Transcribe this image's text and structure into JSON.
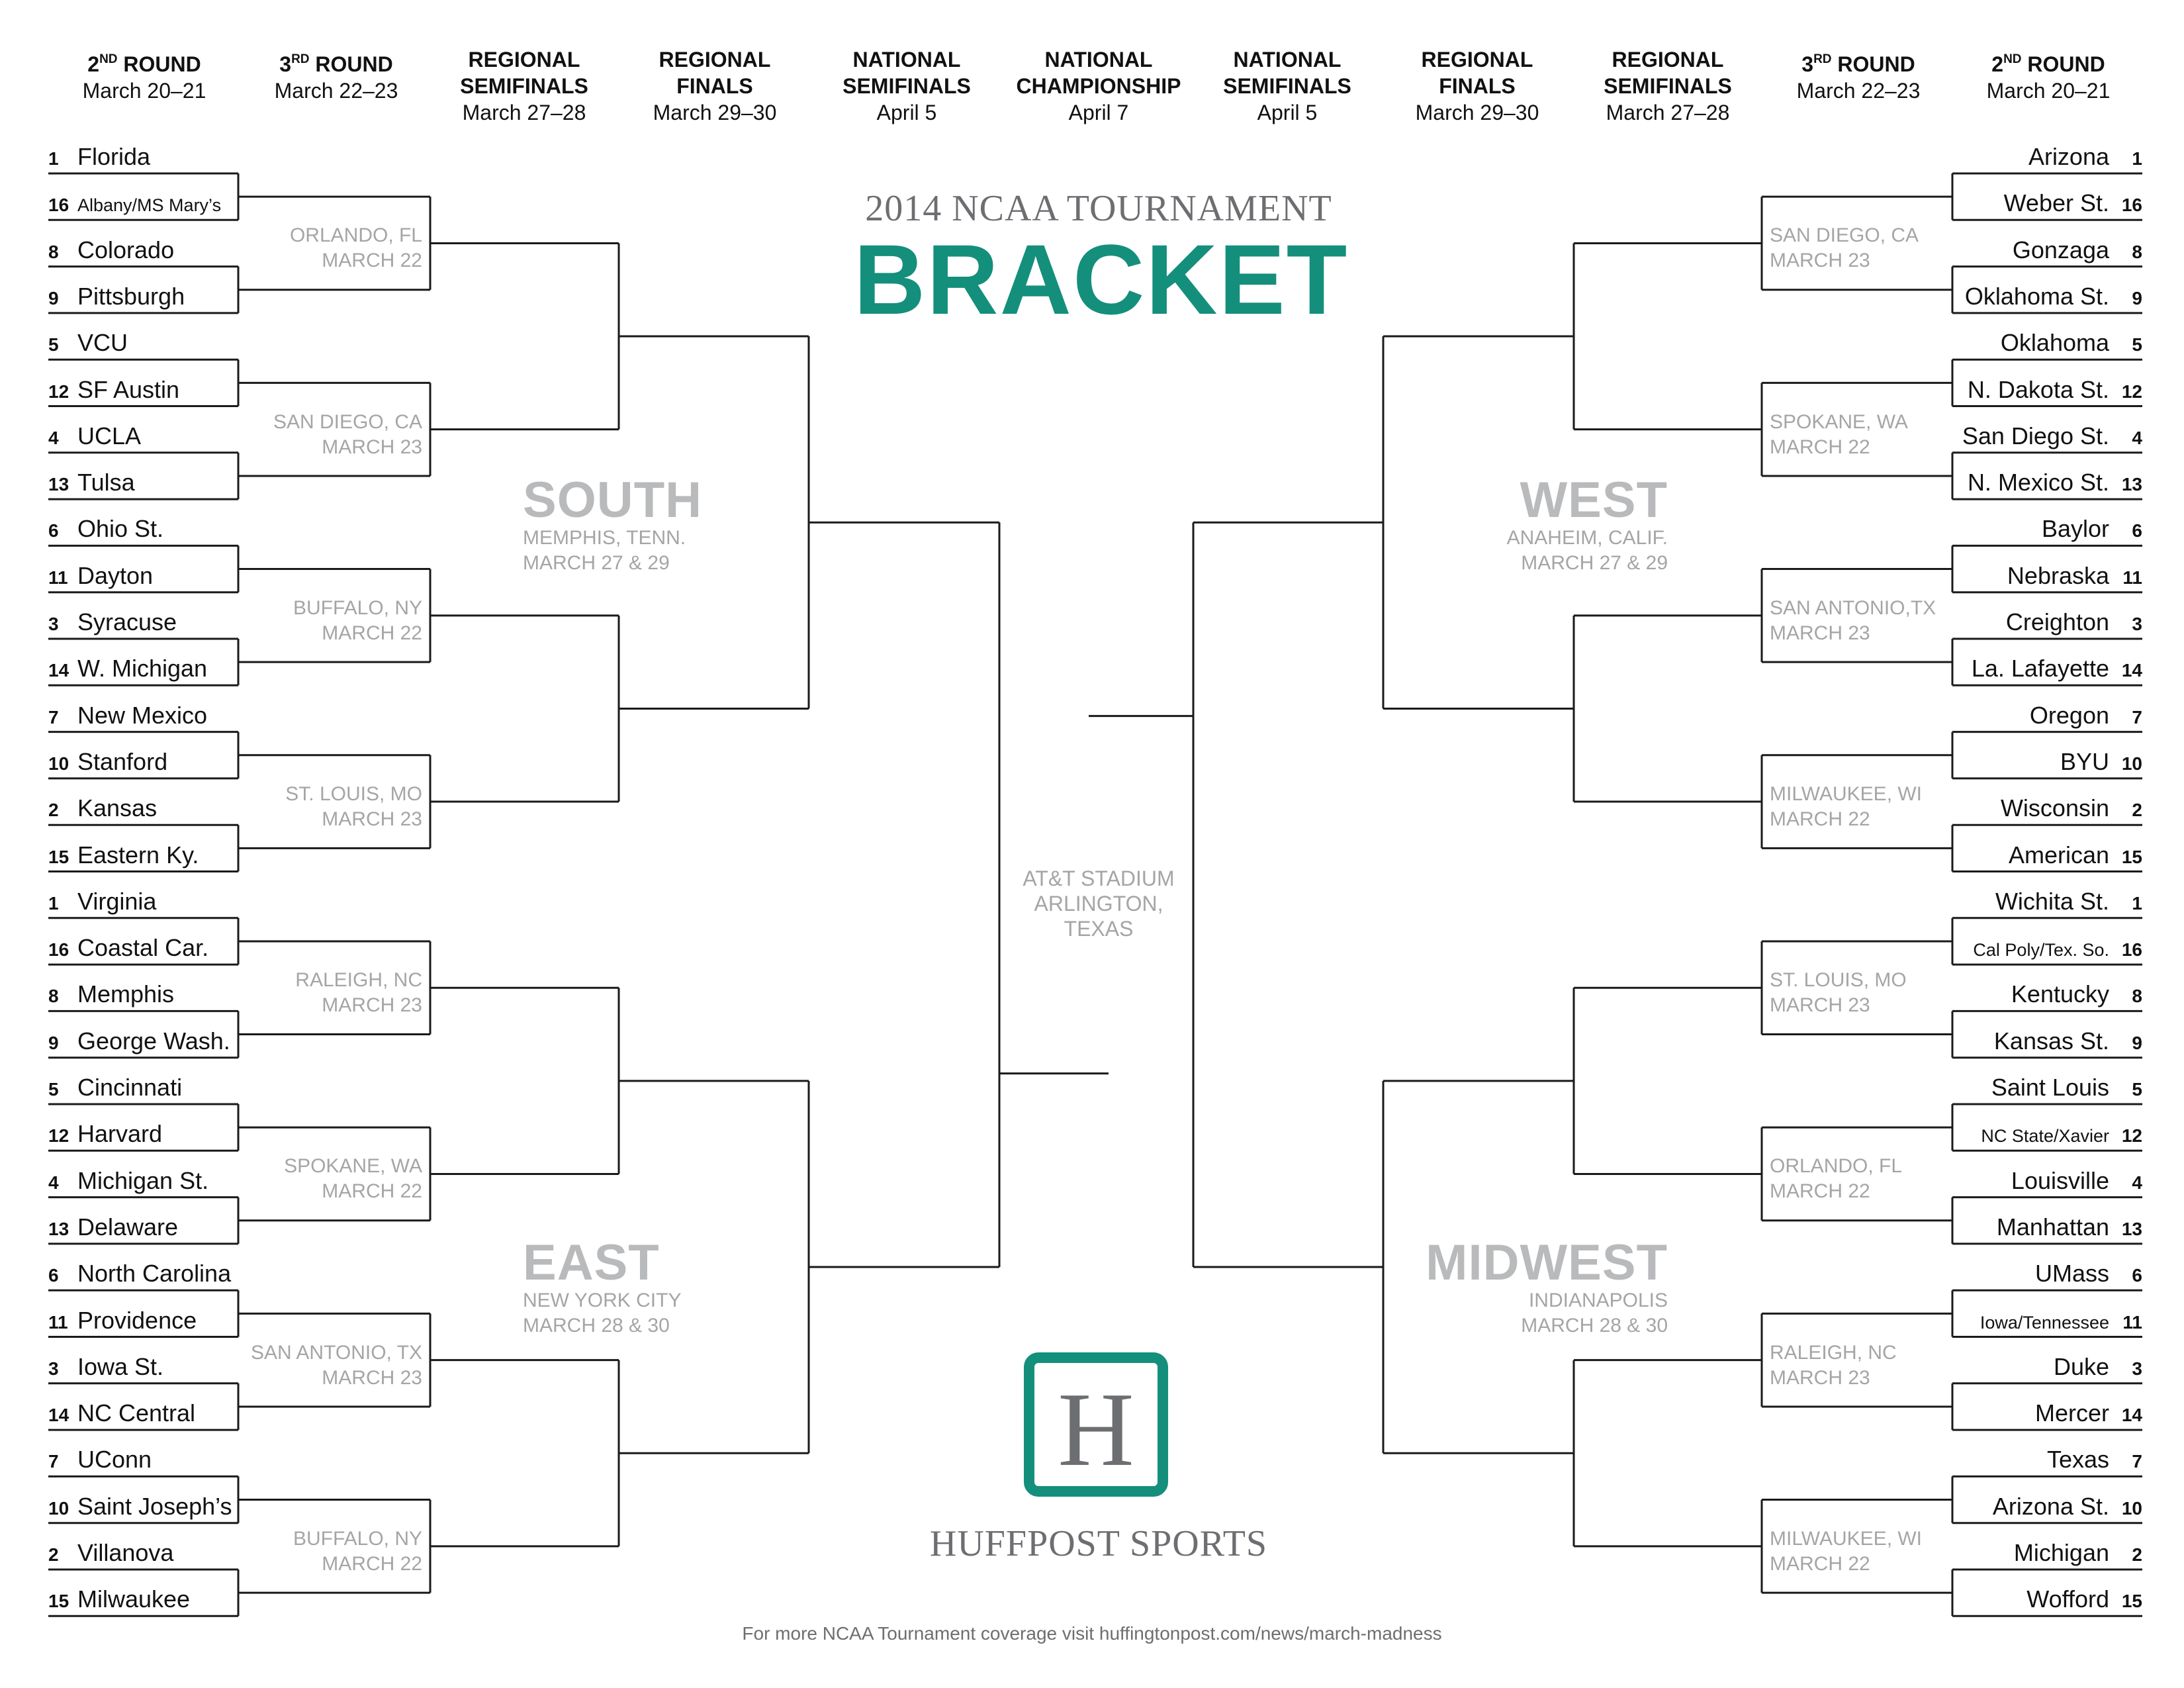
{
  "headers": [
    {
      "title": "2ND ROUND",
      "ord": "ND",
      "num": "2",
      "word": "ROUND",
      "date": "March 20–21"
    },
    {
      "title": "3RD ROUND",
      "ord": "RD",
      "num": "3",
      "word": "ROUND",
      "date": "March 22–23"
    },
    {
      "line1": "REGIONAL",
      "line2": "SEMIFINALS",
      "date": "March 27–28"
    },
    {
      "line1": "REGIONAL",
      "line2": "FINALS",
      "date": "March 29–30"
    },
    {
      "line1": "NATIONAL",
      "line2": "SEMIFINALS",
      "date": "April 5"
    },
    {
      "line1": "NATIONAL",
      "line2": "CHAMPIONSHIP",
      "date": "April 7"
    },
    {
      "line1": "NATIONAL",
      "line2": "SEMIFINALS",
      "date": "April 5"
    },
    {
      "line1": "REGIONAL",
      "line2": "FINALS",
      "date": "March 29–30"
    },
    {
      "line1": "REGIONAL",
      "line2": "SEMIFINALS",
      "date": "March 27–28"
    },
    {
      "title": "3RD ROUND",
      "ord": "RD",
      "num": "3",
      "word": "ROUND",
      "date": "March 22–23"
    },
    {
      "title": "2ND ROUND",
      "ord": "ND",
      "num": "2",
      "word": "ROUND",
      "date": "March 20–21"
    }
  ],
  "title": {
    "top": "2014 NCAA TOURNAMENT",
    "main": "BRACKET"
  },
  "championship_venue": [
    "AT&T STADIUM",
    "ARLINGTON,",
    "TEXAS"
  ],
  "logo": {
    "letter": "H",
    "text": "HUFFPOST SPORTS",
    "accent_color": "#148f7c"
  },
  "footer": "For more NCAA Tournament coverage visit huffingtonpost.com/news/march-madness",
  "regions": {
    "south": {
      "name": "SOUTH",
      "city": "MEMPHIS, TENN.",
      "dates": "MARCH 27 & 29"
    },
    "east": {
      "name": "EAST",
      "city": "NEW YORK CITY",
      "dates": "MARCH 28 & 30"
    },
    "west": {
      "name": "WEST",
      "city": "ANAHEIM, CALIF.",
      "dates": "MARCH 27 & 29"
    },
    "midwest": {
      "name": "MIDWEST",
      "city": "INDIANAPOLIS",
      "dates": "MARCH 28 & 30"
    }
  },
  "left_teams": [
    {
      "seed": "1",
      "name": "Florida"
    },
    {
      "seed": "16",
      "name": "Albany/MS Mary’s",
      "small": true
    },
    {
      "seed": "8",
      "name": "Colorado"
    },
    {
      "seed": "9",
      "name": "Pittsburgh"
    },
    {
      "seed": "5",
      "name": "VCU"
    },
    {
      "seed": "12",
      "name": "SF Austin"
    },
    {
      "seed": "4",
      "name": "UCLA"
    },
    {
      "seed": "13",
      "name": "Tulsa"
    },
    {
      "seed": "6",
      "name": "Ohio St."
    },
    {
      "seed": "11",
      "name": "Dayton"
    },
    {
      "seed": "3",
      "name": "Syracuse"
    },
    {
      "seed": "14",
      "name": "W. Michigan"
    },
    {
      "seed": "7",
      "name": "New Mexico"
    },
    {
      "seed": "10",
      "name": "Stanford"
    },
    {
      "seed": "2",
      "name": "Kansas"
    },
    {
      "seed": "15",
      "name": "Eastern Ky."
    },
    {
      "seed": "1",
      "name": "Virginia"
    },
    {
      "seed": "16",
      "name": "Coastal Car."
    },
    {
      "seed": "8",
      "name": "Memphis"
    },
    {
      "seed": "9",
      "name": "George Wash."
    },
    {
      "seed": "5",
      "name": "Cincinnati"
    },
    {
      "seed": "12",
      "name": "Harvard"
    },
    {
      "seed": "4",
      "name": "Michigan St."
    },
    {
      "seed": "13",
      "name": "Delaware"
    },
    {
      "seed": "6",
      "name": "North Carolina"
    },
    {
      "seed": "11",
      "name": "Providence"
    },
    {
      "seed": "3",
      "name": "Iowa St."
    },
    {
      "seed": "14",
      "name": "NC Central"
    },
    {
      "seed": "7",
      "name": "UConn"
    },
    {
      "seed": "10",
      "name": "Saint Joseph’s"
    },
    {
      "seed": "2",
      "name": "Villanova"
    },
    {
      "seed": "15",
      "name": "Milwaukee"
    }
  ],
  "right_teams": [
    {
      "seed": "1",
      "name": "Arizona"
    },
    {
      "seed": "16",
      "name": "Weber St."
    },
    {
      "seed": "8",
      "name": "Gonzaga"
    },
    {
      "seed": "9",
      "name": "Oklahoma St."
    },
    {
      "seed": "5",
      "name": "Oklahoma"
    },
    {
      "seed": "12",
      "name": "N. Dakota St."
    },
    {
      "seed": "4",
      "name": "San Diego St."
    },
    {
      "seed": "13",
      "name": "N. Mexico St."
    },
    {
      "seed": "6",
      "name": "Baylor"
    },
    {
      "seed": "11",
      "name": "Nebraska"
    },
    {
      "seed": "3",
      "name": "Creighton"
    },
    {
      "seed": "14",
      "name": "La. Lafayette"
    },
    {
      "seed": "7",
      "name": "Oregon"
    },
    {
      "seed": "10",
      "name": "BYU"
    },
    {
      "seed": "2",
      "name": "Wisconsin"
    },
    {
      "seed": "15",
      "name": "American"
    },
    {
      "seed": "1",
      "name": "Wichita St."
    },
    {
      "seed": "16",
      "name": "Cal Poly/Tex. So.",
      "small": true
    },
    {
      "seed": "8",
      "name": "Kentucky"
    },
    {
      "seed": "9",
      "name": "Kansas St."
    },
    {
      "seed": "5",
      "name": "Saint Louis"
    },
    {
      "seed": "12",
      "name": "NC State/Xavier",
      "small": true
    },
    {
      "seed": "4",
      "name": "Louisville"
    },
    {
      "seed": "13",
      "name": "Manhattan"
    },
    {
      "seed": "6",
      "name": "UMass"
    },
    {
      "seed": "11",
      "name": "Iowa/Tennessee",
      "small": true
    },
    {
      "seed": "3",
      "name": "Duke"
    },
    {
      "seed": "14",
      "name": "Mercer"
    },
    {
      "seed": "7",
      "name": "Texas"
    },
    {
      "seed": "10",
      "name": "Arizona St."
    },
    {
      "seed": "2",
      "name": "Michigan"
    },
    {
      "seed": "15",
      "name": "Wofford"
    }
  ],
  "left_venues": [
    {
      "city": "ORLANDO, FL",
      "date": "MARCH 22"
    },
    {
      "city": "SAN DIEGO, CA",
      "date": "MARCH 23"
    },
    {
      "city": "BUFFALO, NY",
      "date": "MARCH 22"
    },
    {
      "city": "ST. LOUIS, MO",
      "date": "MARCH 23"
    },
    {
      "city": "RALEIGH, NC",
      "date": "MARCH 23"
    },
    {
      "city": "SPOKANE, WA",
      "date": "MARCH 22"
    },
    {
      "city": "SAN ANTONIO, TX",
      "date": "MARCH 23"
    },
    {
      "city": "BUFFALO, NY",
      "date": "MARCH 22"
    }
  ],
  "right_venues": [
    {
      "city": "SAN DIEGO, CA",
      "date": "MARCH 23"
    },
    {
      "city": "SPOKANE, WA",
      "date": "MARCH 22"
    },
    {
      "city": "SAN ANTONIO,TX",
      "date": "MARCH 23"
    },
    {
      "city": "MILWAUKEE, WI",
      "date": "MARCH 22"
    },
    {
      "city": "ST. LOUIS, MO",
      "date": "MARCH 23"
    },
    {
      "city": "ORLANDO, FL",
      "date": "MARCH 22"
    },
    {
      "city": "RALEIGH, NC",
      "date": "MARCH 23"
    },
    {
      "city": "MILWAUKEE, WI",
      "date": "MARCH 22"
    }
  ]
}
